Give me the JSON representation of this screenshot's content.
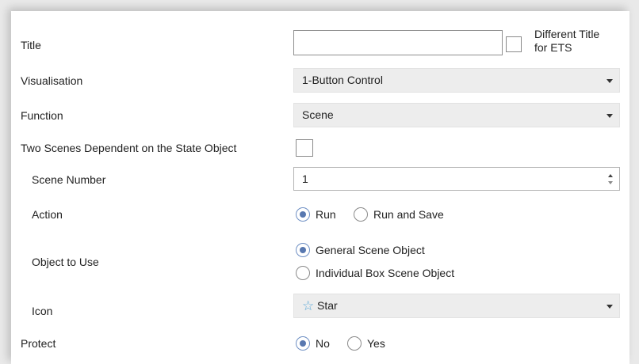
{
  "title_row": {
    "label": "Title",
    "value": "",
    "checkbox_label_line1": "Different Title",
    "checkbox_label_line2": "for ETS"
  },
  "visualisation": {
    "label": "Visualisation",
    "value": "1-Button Control"
  },
  "function": {
    "label": "Function",
    "value": "Scene"
  },
  "two_scenes": {
    "label": "Two Scenes Dependent on the State Object"
  },
  "scene_number": {
    "label": "Scene Number",
    "value": "1"
  },
  "action": {
    "label": "Action",
    "options": [
      "Run",
      "Run and Save"
    ],
    "selected": "Run"
  },
  "object_to_use": {
    "label": "Object to Use",
    "options": [
      "General Scene Object",
      "Individual Box Scene Object"
    ],
    "selected": "General Scene Object"
  },
  "icon": {
    "label": "Icon",
    "value": "Star",
    "icon": "star-icon",
    "icon_color": "#5aa8d8"
  },
  "protect": {
    "label": "Protect",
    "options": [
      "No",
      "Yes"
    ],
    "selected": "No"
  },
  "colors": {
    "radio_selected": "#5878b0",
    "combo_bg": "#ededed"
  }
}
